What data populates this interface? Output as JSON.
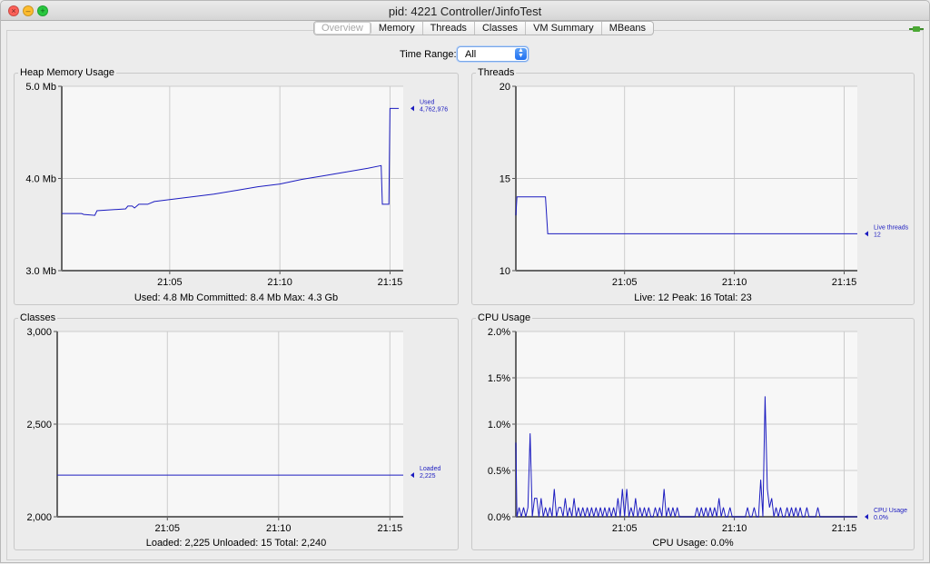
{
  "window": {
    "title": "pid: 4221 Controller/JinfoTest"
  },
  "tabs": [
    "Overview",
    "Memory",
    "Threads",
    "Classes",
    "VM Summary",
    "MBeans"
  ],
  "active_tab": "Overview",
  "time_range": {
    "label": "Time Range:",
    "value": "All"
  },
  "colors": {
    "series": "#1c1cc0",
    "grid": "#cccccc",
    "plot_bg": "#f7f7f7"
  },
  "heap": {
    "title": "Heap Memory Usage",
    "footer": "Used: 4.8 Mb    Committed: 8.4 Mb    Max: 4.3 Gb",
    "marker_name": "Used",
    "marker_value": "4,762,976"
  },
  "threads": {
    "title": "Threads",
    "footer": "Live: 12    Peak: 16    Total: 23",
    "marker_name": "Live threads",
    "marker_value": "12"
  },
  "classes": {
    "title": "Classes",
    "footer": "Loaded: 2,225    Unloaded: 15    Total: 2,240",
    "marker_name": "Loaded",
    "marker_value": "2,225"
  },
  "cpu": {
    "title": "CPU Usage",
    "footer": "CPU Usage: 0.0%",
    "marker_name": "CPU Usage",
    "marker_value": "0.0%"
  },
  "chart_data": [
    {
      "id": "heap",
      "type": "line",
      "title": "Heap Memory Usage",
      "x_ticks": [
        "21:05",
        "21:10",
        "21:15"
      ],
      "x_tick_values": [
        5,
        10,
        15
      ],
      "xlim": [
        0.1,
        15.6
      ],
      "y_ticks": [
        "3.0 Mb",
        "4.0 Mb",
        "5.0 Mb"
      ],
      "y_tick_values": [
        3.0,
        4.0,
        5.0
      ],
      "ylim": [
        3.0,
        5.0
      ],
      "series": [
        {
          "name": "Used",
          "x": [
            0.1,
            1.0,
            1.1,
            1.6,
            1.7,
            3.0,
            3.1,
            3.3,
            3.4,
            3.6,
            4.0,
            4.3,
            5.0,
            6.0,
            7.0,
            8.0,
            9.0,
            10.0,
            11.0,
            12.0,
            13.0,
            14.0,
            14.6,
            14.65,
            14.9,
            14.95,
            15.0,
            15.1,
            15.2,
            15.4
          ],
          "y": [
            3.62,
            3.62,
            3.61,
            3.6,
            3.65,
            3.67,
            3.7,
            3.7,
            3.68,
            3.72,
            3.72,
            3.75,
            3.77,
            3.8,
            3.83,
            3.87,
            3.91,
            3.94,
            3.99,
            4.03,
            4.07,
            4.11,
            4.14,
            3.72,
            3.72,
            3.72,
            4.76,
            4.76,
            4.76,
            4.76
          ]
        }
      ]
    },
    {
      "id": "threads",
      "type": "line",
      "title": "Threads",
      "x_ticks": [
        "21:05",
        "21:10",
        "21:15"
      ],
      "x_tick_values": [
        5,
        10,
        15
      ],
      "xlim": [
        0.05,
        15.6
      ],
      "y_ticks": [
        "10",
        "15",
        "20"
      ],
      "y_tick_values": [
        10,
        15,
        20
      ],
      "ylim": [
        10,
        20
      ],
      "series": [
        {
          "name": "Live threads",
          "x": [
            0.05,
            0.1,
            1.4,
            1.5,
            15.6
          ],
          "y": [
            13,
            14,
            14,
            12,
            12
          ]
        }
      ]
    },
    {
      "id": "classes",
      "type": "line",
      "title": "Classes",
      "x_ticks": [
        "21:05",
        "21:10",
        "21:15"
      ],
      "x_tick_values": [
        5,
        10,
        15
      ],
      "xlim": [
        0.05,
        15.6
      ],
      "y_ticks": [
        "2,000",
        "2,500",
        "3,000"
      ],
      "y_tick_values": [
        2000,
        2500,
        3000
      ],
      "ylim": [
        2000,
        3000
      ],
      "series": [
        {
          "name": "Loaded",
          "x": [
            0.05,
            15.6
          ],
          "y": [
            2225,
            2225
          ]
        }
      ]
    },
    {
      "id": "cpu",
      "type": "line",
      "title": "CPU Usage",
      "x_ticks": [
        "21:05",
        "21:10",
        "21:15"
      ],
      "x_tick_values": [
        5,
        10,
        15
      ],
      "xlim": [
        0.05,
        15.6
      ],
      "y_ticks": [
        "0.0%",
        "0.5%",
        "1.0%",
        "1.5%",
        "2.0%"
      ],
      "y_tick_values": [
        0.0,
        0.5,
        1.0,
        1.5,
        2.0
      ],
      "ylim": [
        0.0,
        2.0
      ],
      "series": [
        {
          "name": "CPU Usage",
          "x": [
            0.05,
            0.1,
            0.2,
            0.3,
            0.4,
            0.5,
            0.6,
            0.7,
            0.8,
            0.9,
            1.0,
            1.1,
            1.2,
            1.3,
            1.4,
            1.5,
            1.6,
            1.7,
            1.8,
            1.9,
            2.0,
            2.1,
            2.2,
            2.3,
            2.4,
            2.5,
            2.6,
            2.7,
            2.8,
            2.9,
            3.0,
            3.1,
            3.2,
            3.3,
            3.4,
            3.5,
            3.6,
            3.7,
            3.8,
            3.9,
            4.0,
            4.1,
            4.2,
            4.3,
            4.4,
            4.5,
            4.6,
            4.7,
            4.8,
            4.9,
            5.0,
            5.1,
            5.2,
            5.3,
            5.4,
            5.5,
            5.6,
            5.7,
            5.8,
            5.9,
            6.0,
            6.1,
            6.2,
            6.3,
            6.4,
            6.5,
            6.6,
            6.7,
            6.8,
            6.9,
            7.0,
            7.1,
            7.2,
            7.3,
            7.4,
            7.5,
            7.6,
            7.7,
            7.8,
            7.9,
            8.0,
            8.1,
            8.2,
            8.3,
            8.4,
            8.5,
            8.6,
            8.7,
            8.8,
            8.9,
            9.0,
            9.1,
            9.2,
            9.3,
            9.4,
            9.5,
            9.6,
            9.7,
            9.8,
            9.9,
            10.0,
            10.1,
            10.2,
            10.3,
            10.4,
            10.5,
            10.6,
            10.7,
            10.8,
            10.9,
            11.0,
            11.1,
            11.2,
            11.3,
            11.4,
            11.5,
            11.6,
            11.7,
            11.8,
            11.9,
            12.0,
            12.1,
            12.2,
            12.3,
            12.4,
            12.5,
            12.6,
            12.7,
            12.8,
            12.9,
            13.0,
            13.1,
            13.2,
            13.3,
            13.4,
            13.5,
            13.6,
            13.7,
            13.8,
            13.9,
            14.0,
            14.1,
            14.2,
            14.3,
            14.4,
            14.5,
            14.6,
            14.7,
            14.8,
            14.9,
            15.0,
            15.6
          ],
          "y": [
            0.8,
            0.0,
            0.1,
            0.0,
            0.1,
            0.0,
            0.1,
            0.9,
            0.0,
            0.2,
            0.2,
            0.0,
            0.2,
            0.0,
            0.1,
            0.0,
            0.1,
            0.0,
            0.3,
            0.0,
            0.1,
            0.1,
            0.0,
            0.2,
            0.0,
            0.1,
            0.0,
            0.2,
            0.0,
            0.1,
            0.0,
            0.1,
            0.0,
            0.1,
            0.0,
            0.1,
            0.0,
            0.1,
            0.0,
            0.1,
            0.0,
            0.1,
            0.0,
            0.1,
            0.0,
            0.1,
            0.0,
            0.2,
            0.0,
            0.3,
            0.0,
            0.3,
            0.0,
            0.1,
            0.0,
            0.2,
            0.0,
            0.1,
            0.0,
            0.1,
            0.0,
            0.1,
            0.0,
            0.0,
            0.1,
            0.0,
            0.1,
            0.0,
            0.3,
            0.0,
            0.1,
            0.0,
            0.1,
            0.0,
            0.1,
            0.0,
            0.0,
            0.0,
            0.0,
            0.0,
            0.0,
            0.0,
            0.0,
            0.1,
            0.0,
            0.1,
            0.0,
            0.1,
            0.0,
            0.1,
            0.0,
            0.1,
            0.0,
            0.2,
            0.0,
            0.1,
            0.0,
            0.0,
            0.1,
            0.0,
            0.0,
            0.0,
            0.0,
            0.0,
            0.0,
            0.0,
            0.1,
            0.0,
            0.0,
            0.1,
            0.0,
            0.0,
            0.4,
            0.0,
            1.3,
            0.3,
            0.1,
            0.2,
            0.0,
            0.1,
            0.0,
            0.1,
            0.0,
            0.0,
            0.1,
            0.0,
            0.1,
            0.0,
            0.1,
            0.0,
            0.1,
            0.0,
            0.0,
            0.1,
            0.0,
            0.0,
            0.0,
            0.0,
            0.1,
            0.0,
            0.0,
            0.0,
            0.0,
            0.0,
            0.0,
            0.0,
            0.0,
            0.0,
            0.0,
            0.0,
            0.0,
            0.0
          ]
        }
      ]
    }
  ]
}
